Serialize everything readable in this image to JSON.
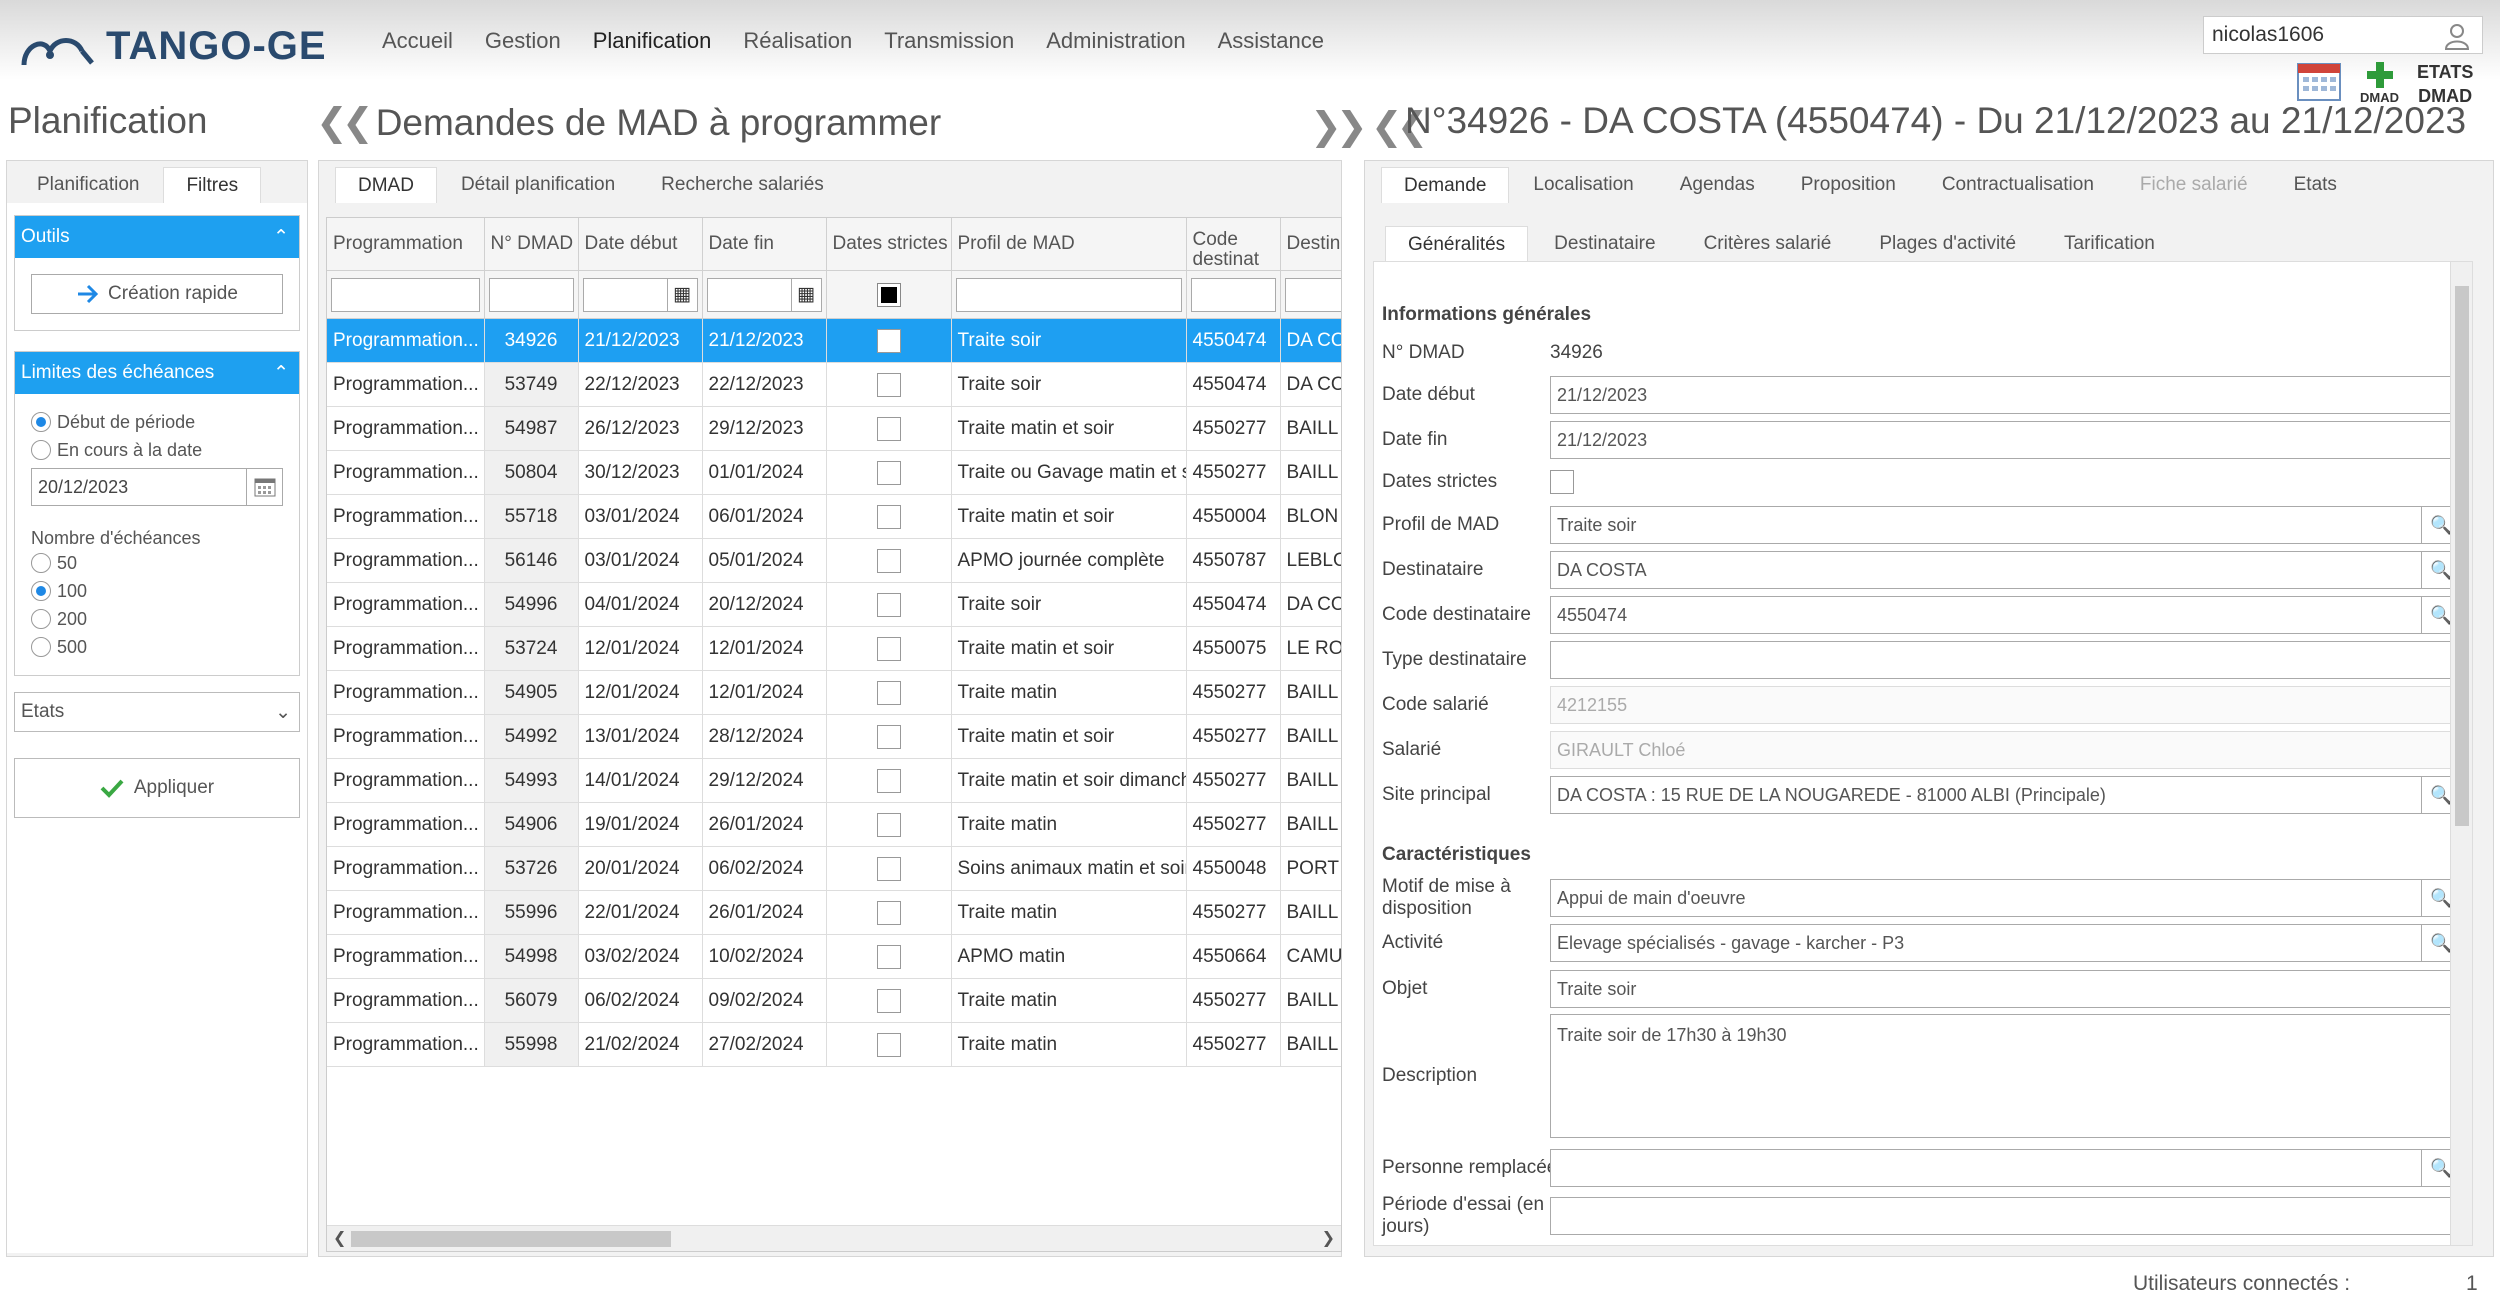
{
  "app": {
    "logo_text": "TANGO-GE",
    "nav": [
      "Accueil",
      "Gestion",
      "Planification",
      "Réalisation",
      "Transmission",
      "Administration",
      "Assistance"
    ],
    "active_nav": "Planification",
    "user": "nicolas1606",
    "actions": {
      "dmad_label": "DMAD",
      "etats_label": "ETATS",
      "etats_sub": "DMAD"
    },
    "accent": "#1ea0f0"
  },
  "left": {
    "title": "Planification",
    "tabs": [
      "Planification",
      "Filtres"
    ],
    "tools_title": "Outils",
    "quick_create": "Création rapide",
    "limits_title": "Limites des échéances",
    "radio_period": "Début de période",
    "radio_current": "En cours à la date",
    "date_value": "20/12/2023",
    "count_label": "Nombre d'échéances",
    "counts": [
      "50",
      "100",
      "200",
      "500"
    ],
    "etats_select": "Etats",
    "apply": "Appliquer"
  },
  "middle": {
    "title": "Demandes de MAD à programmer",
    "tabs": [
      "DMAD",
      "Détail planification",
      "Recherche salariés"
    ],
    "columns": [
      "Programmation",
      "N° DMAD",
      "Date début",
      "Date fin",
      "Dates strictes",
      "Profil de MAD",
      "Code destinat",
      "Destin"
    ],
    "rows": [
      [
        "Programmation...",
        "34926",
        "21/12/2023",
        "21/12/2023",
        "Traite soir",
        "4550474",
        "DA CO"
      ],
      [
        "Programmation...",
        "53749",
        "22/12/2023",
        "22/12/2023",
        "Traite soir",
        "4550474",
        "DA CO"
      ],
      [
        "Programmation...",
        "54987",
        "26/12/2023",
        "29/12/2023",
        "Traite matin et soir",
        "4550277",
        "BAILL"
      ],
      [
        "Programmation...",
        "50804",
        "30/12/2023",
        "01/01/2024",
        "Traite ou Gavage matin et s",
        "4550277",
        "BAILL"
      ],
      [
        "Programmation...",
        "55718",
        "03/01/2024",
        "06/01/2024",
        "Traite matin et soir",
        "4550004",
        "BLON"
      ],
      [
        "Programmation...",
        "56146",
        "03/01/2024",
        "05/01/2024",
        "APMO journée complète",
        "4550787",
        "LEBLO"
      ],
      [
        "Programmation...",
        "54996",
        "04/01/2024",
        "20/12/2024",
        "Traite soir",
        "4550474",
        "DA CO"
      ],
      [
        "Programmation...",
        "53724",
        "12/01/2024",
        "12/01/2024",
        "Traite matin et soir",
        "4550075",
        "LE RO"
      ],
      [
        "Programmation...",
        "54905",
        "12/01/2024",
        "12/01/2024",
        "Traite matin",
        "4550277",
        "BAILL"
      ],
      [
        "Programmation...",
        "54992",
        "13/01/2024",
        "28/12/2024",
        "Traite matin et soir",
        "4550277",
        "BAILL"
      ],
      [
        "Programmation...",
        "54993",
        "14/01/2024",
        "29/12/2024",
        "Traite matin et soir dimanch",
        "4550277",
        "BAILL"
      ],
      [
        "Programmation...",
        "54906",
        "19/01/2024",
        "26/01/2024",
        "Traite matin",
        "4550277",
        "BAILL"
      ],
      [
        "Programmation...",
        "53726",
        "20/01/2024",
        "06/02/2024",
        "Soins animaux matin et soir",
        "4550048",
        "PORT"
      ],
      [
        "Programmation...",
        "55996",
        "22/01/2024",
        "26/01/2024",
        "Traite matin",
        "4550277",
        "BAILL"
      ],
      [
        "Programmation...",
        "54998",
        "03/02/2024",
        "10/02/2024",
        "APMO matin",
        "4550664",
        "CAMU"
      ],
      [
        "Programmation...",
        "56079",
        "06/02/2024",
        "09/02/2024",
        "Traite matin",
        "4550277",
        "BAILL"
      ],
      [
        "Programmation...",
        "55998",
        "21/02/2024",
        "27/02/2024",
        "Traite matin",
        "4550277",
        "BAILL"
      ]
    ]
  },
  "right": {
    "title": "N°34926 - DA COSTA (4550474) - Du 21/12/2023 au 21/12/2023",
    "tabs": [
      "Demande",
      "Localisation",
      "Agendas",
      "Proposition",
      "Contractualisation",
      "Fiche salarié",
      "Etats"
    ],
    "subtabs": [
      "Généralités",
      "Destinataire",
      "Critères salarié",
      "Plages d'activité",
      "Tarification"
    ],
    "section1": "Informations générales",
    "section2": "Caractéristiques",
    "fields": {
      "n_dmad_label": "N° DMAD",
      "n_dmad": "34926",
      "date_debut_label": "Date début",
      "date_debut": "21/12/2023",
      "date_fin_label": "Date fin",
      "date_fin": "21/12/2023",
      "dates_strictes_label": "Dates strictes",
      "profil_label": "Profil de MAD",
      "profil": "Traite soir",
      "destinataire_label": "Destinataire",
      "destinataire": "DA COSTA",
      "code_dest_label": "Code destinataire",
      "code_dest": "4550474",
      "type_dest_label": "Type destinataire",
      "type_dest": "",
      "code_sal_label": "Code salarié",
      "code_sal": "4212155",
      "salarie_label": "Salarié",
      "salarie": "GIRAULT Chloé",
      "site_label": "Site principal",
      "site": "DA COSTA  :  15 RUE DE LA NOUGAREDE  -  81000   ALBI  (Principale)",
      "motif_label": "Motif de mise à disposition",
      "motif": "Appui de main d'oeuvre",
      "activite_label": "Activité",
      "activite": "Elevage spécialisés - gavage - karcher - P3",
      "objet_label": "Objet",
      "objet": "Traite soir",
      "description_label": "Description",
      "description": "Traite soir de 17h30 à 19h30",
      "remplacee_label": "Personne remplacée",
      "remplacee": "",
      "essai_label": "Période d'essai (en jours)",
      "essai": ""
    }
  },
  "footer": {
    "label": "Utilisateurs connectés :",
    "count": "1"
  }
}
